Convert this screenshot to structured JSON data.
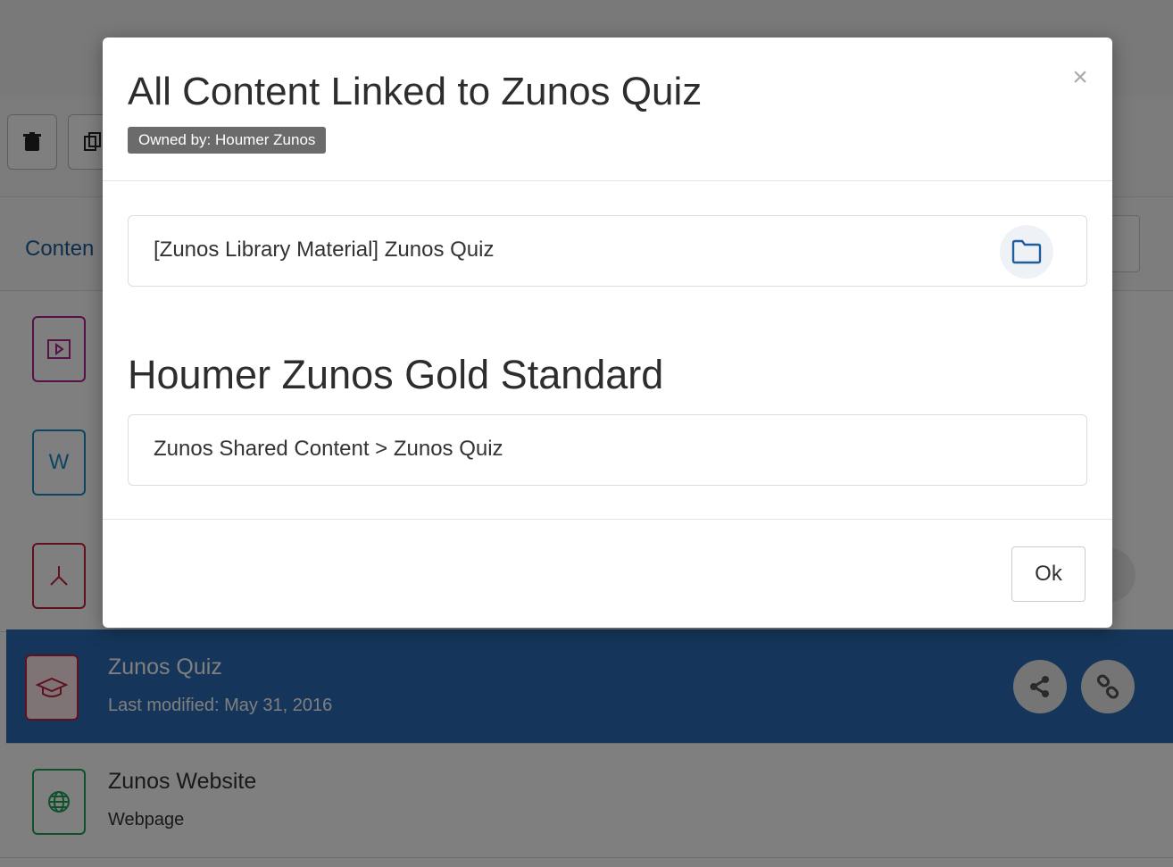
{
  "background": {
    "tab_label": "Conten",
    "rows": [
      {
        "title": "",
        "subtitle": "",
        "icon": "video-file-icon",
        "color": "#b0238f"
      },
      {
        "title": "",
        "subtitle": "",
        "icon": "word-file-icon",
        "glyph": "W",
        "color": "#1d8ac0"
      },
      {
        "title": "",
        "subtitle": "",
        "icon": "pdf-file-icon",
        "color": "#c0223a"
      },
      {
        "title": "Zunos Quiz",
        "subtitle": "Last modified: May 31, 2016",
        "icon": "graduation-cap-icon",
        "color": "#c0223a",
        "selected": true
      },
      {
        "title": "Zunos Website",
        "subtitle": "Webpage",
        "icon": "globe-file-icon",
        "color": "#1ea05a"
      }
    ]
  },
  "modal": {
    "title": "All Content Linked to Zunos Quiz",
    "owner_badge": "Owned by: Houmer Zunos",
    "close_label": "×",
    "library_item": "[Zunos Library Material] Zunos Quiz",
    "section_heading": "Houmer Zunos Gold Standard",
    "shared_path": "Zunos Shared Content > Zunos Quiz",
    "ok_label": "Ok"
  },
  "colors": {
    "selected_row": "#2b6db5",
    "accent_blue": "#1f5d9c",
    "badge_bg": "#6b6b6b"
  }
}
